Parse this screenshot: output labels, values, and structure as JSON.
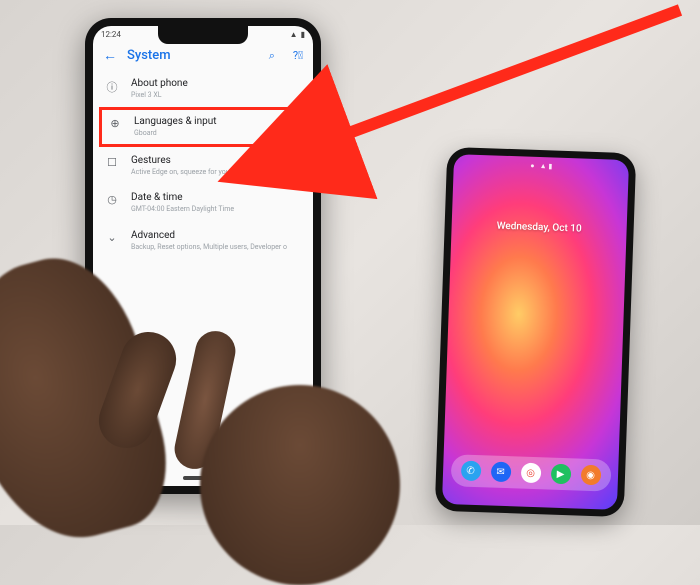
{
  "annotation": {
    "highlight_color": "#ff2a1a"
  },
  "phone_left": {
    "status": {
      "time": "12:24"
    },
    "title": "System",
    "items": [
      {
        "icon": "ⓘ",
        "title": "About phone",
        "sub": "Pixel 3 XL"
      },
      {
        "icon": "⊕",
        "title": "Languages & input",
        "sub": "Gboard"
      },
      {
        "icon": "☐",
        "title": "Gestures",
        "sub": "Active Edge on, squeeze for your Assistant"
      },
      {
        "icon": "◷",
        "title": "Date & time",
        "sub": "GMT-04:00 Eastern Daylight Time"
      },
      {
        "icon": "⌄",
        "title": "Advanced",
        "sub": "Backup, Reset options, Multiple users, Developer o"
      }
    ]
  },
  "phone_right": {
    "date": "Wednesday, Oct 10",
    "dock": [
      {
        "name": "phone",
        "color": "#2aa3f0",
        "glyph": "✆"
      },
      {
        "name": "messages",
        "color": "#1e66f5",
        "glyph": "✉"
      },
      {
        "name": "chrome",
        "color": "#ffffff",
        "glyph": "◎"
      },
      {
        "name": "play-store",
        "color": "#20c060",
        "glyph": "▶"
      },
      {
        "name": "camera",
        "color": "#f27b2c",
        "glyph": "◉"
      }
    ]
  }
}
